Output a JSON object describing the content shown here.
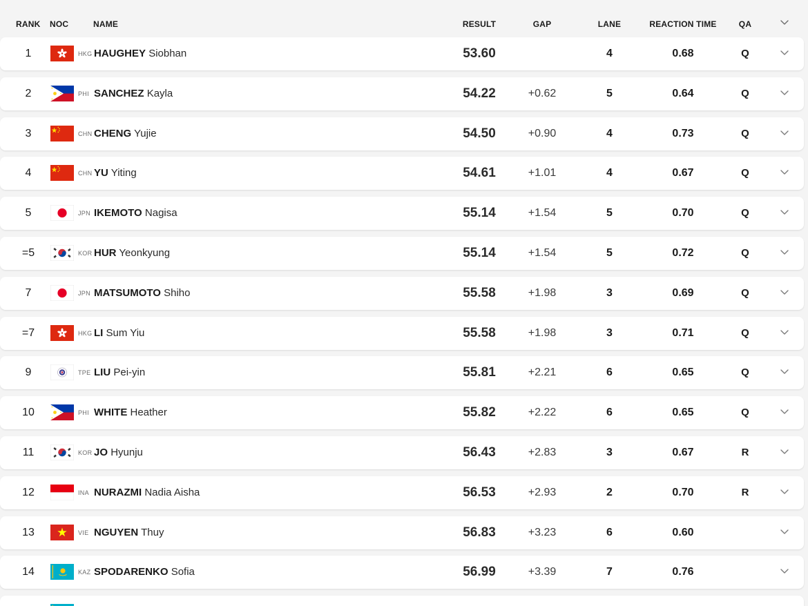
{
  "columns": {
    "rank": "RANK",
    "noc": "NOC",
    "name": "NAME",
    "result": "RESULT",
    "gap": "GAP",
    "lane": "LANE",
    "reaction_time": "REACTION TIME",
    "qa": "QA"
  },
  "flags": {
    "HKG": "hong-kong-flag-icon",
    "PHI": "philippines-flag-icon",
    "CHN": "china-flag-icon",
    "JPN": "japan-flag-icon",
    "KOR": "korea-flag-icon",
    "TPE": "chinese-taipei-flag-icon",
    "INA": "indonesia-flag-icon",
    "VIE": "vietnam-flag-icon",
    "KAZ": "kazakhstan-flag-icon"
  },
  "rows": [
    {
      "rank": "1",
      "noc": "HKG",
      "surname": "HAUGHEY",
      "given": "Siobhan",
      "result": "53.60",
      "gap": "",
      "lane": "4",
      "rt": "0.68",
      "qa": "Q"
    },
    {
      "rank": "2",
      "noc": "PHI",
      "surname": "SANCHEZ",
      "given": "Kayla",
      "result": "54.22",
      "gap": "+0.62",
      "lane": "5",
      "rt": "0.64",
      "qa": "Q"
    },
    {
      "rank": "3",
      "noc": "CHN",
      "surname": "CHENG",
      "given": "Yujie",
      "result": "54.50",
      "gap": "+0.90",
      "lane": "4",
      "rt": "0.73",
      "qa": "Q"
    },
    {
      "rank": "4",
      "noc": "CHN",
      "surname": "YU",
      "given": "Yiting",
      "result": "54.61",
      "gap": "+1.01",
      "lane": "4",
      "rt": "0.67",
      "qa": "Q"
    },
    {
      "rank": "5",
      "noc": "JPN",
      "surname": "IKEMOTO",
      "given": "Nagisa",
      "result": "55.14",
      "gap": "+1.54",
      "lane": "5",
      "rt": "0.70",
      "qa": "Q"
    },
    {
      "rank": "=5",
      "noc": "KOR",
      "surname": "HUR",
      "given": "Yeonkyung",
      "result": "55.14",
      "gap": "+1.54",
      "lane": "5",
      "rt": "0.72",
      "qa": "Q"
    },
    {
      "rank": "7",
      "noc": "JPN",
      "surname": "MATSUMOTO",
      "given": "Shiho",
      "result": "55.58",
      "gap": "+1.98",
      "lane": "3",
      "rt": "0.69",
      "qa": "Q"
    },
    {
      "rank": "=7",
      "noc": "HKG",
      "surname": "LI",
      "given": "Sum Yiu",
      "result": "55.58",
      "gap": "+1.98",
      "lane": "3",
      "rt": "0.71",
      "qa": "Q"
    },
    {
      "rank": "9",
      "noc": "TPE",
      "surname": "LIU",
      "given": "Pei-yin",
      "result": "55.81",
      "gap": "+2.21",
      "lane": "6",
      "rt": "0.65",
      "qa": "Q"
    },
    {
      "rank": "10",
      "noc": "PHI",
      "surname": "WHITE",
      "given": "Heather",
      "result": "55.82",
      "gap": "+2.22",
      "lane": "6",
      "rt": "0.65",
      "qa": "Q"
    },
    {
      "rank": "11",
      "noc": "KOR",
      "surname": "JO",
      "given": "Hyunju",
      "result": "56.43",
      "gap": "+2.83",
      "lane": "3",
      "rt": "0.67",
      "qa": "R"
    },
    {
      "rank": "12",
      "noc": "INA",
      "surname": "NURAZMI",
      "given": "Nadia Aisha",
      "result": "56.53",
      "gap": "+2.93",
      "lane": "2",
      "rt": "0.70",
      "qa": "R"
    },
    {
      "rank": "13",
      "noc": "VIE",
      "surname": "NGUYEN",
      "given": "Thuy",
      "result": "56.83",
      "gap": "+3.23",
      "lane": "6",
      "rt": "0.60",
      "qa": ""
    },
    {
      "rank": "14",
      "noc": "KAZ",
      "surname": "SPODARENKO",
      "given": "Sofia",
      "result": "56.99",
      "gap": "+3.39",
      "lane": "7",
      "rt": "0.76",
      "qa": ""
    },
    {
      "rank": "",
      "noc": "KAZ",
      "surname": "",
      "given": "",
      "result": "",
      "gap": "",
      "lane": "",
      "rt": "",
      "qa": ""
    }
  ]
}
